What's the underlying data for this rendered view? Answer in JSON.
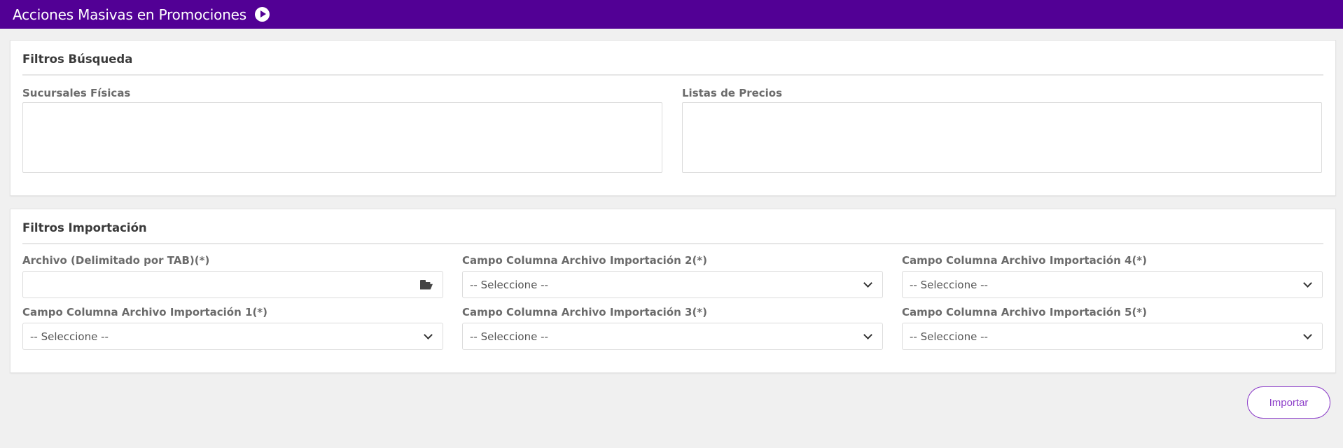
{
  "header": {
    "title": "Acciones Masivas en Promociones",
    "play_icon": "play-circle-icon",
    "background": "#520095"
  },
  "busqueda": {
    "title": "Filtros Búsqueda",
    "sucursales_label": "Sucursales Físicas",
    "listas_label": "Listas de Precios"
  },
  "importacion": {
    "title": "Filtros Importación",
    "archivo_label": "Archivo (Delimitado por TAB)(*)",
    "archivo_value": "",
    "archivo_icon": "folder-open-icon",
    "campo1_label": "Campo Columna Archivo Importación 1(*)",
    "campo1_value": "-- Seleccione --",
    "campo2_label": "Campo Columna Archivo Importación 2(*)",
    "campo2_value": "-- Seleccione --",
    "campo3_label": "Campo Columna Archivo Importación 3(*)",
    "campo3_value": "-- Seleccione --",
    "campo4_label": "Campo Columna Archivo Importación 4(*)",
    "campo4_value": "-- Seleccione --",
    "campo5_label": "Campo Columna Archivo Importación 5(*)",
    "campo5_value": "-- Seleccione --"
  },
  "actions": {
    "import_label": "Importar",
    "accent": "#8d3fc9"
  }
}
